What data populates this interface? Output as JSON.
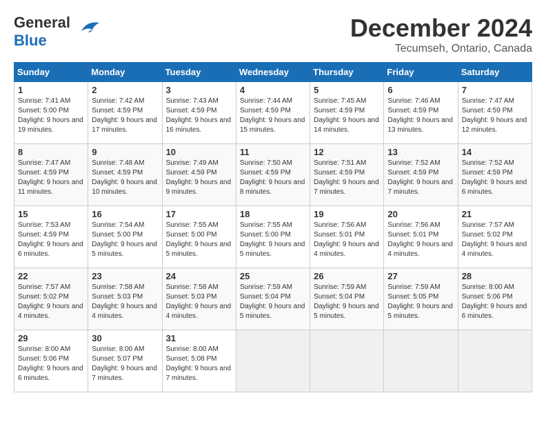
{
  "header": {
    "logo_line1": "General",
    "logo_line2": "Blue",
    "month": "December 2024",
    "location": "Tecumseh, Ontario, Canada"
  },
  "weekdays": [
    "Sunday",
    "Monday",
    "Tuesday",
    "Wednesday",
    "Thursday",
    "Friday",
    "Saturday"
  ],
  "weeks": [
    [
      {
        "day": "1",
        "sunrise": "7:41 AM",
        "sunset": "5:00 PM",
        "daylight": "9 hours and 19 minutes."
      },
      {
        "day": "2",
        "sunrise": "7:42 AM",
        "sunset": "4:59 PM",
        "daylight": "9 hours and 17 minutes."
      },
      {
        "day": "3",
        "sunrise": "7:43 AM",
        "sunset": "4:59 PM",
        "daylight": "9 hours and 16 minutes."
      },
      {
        "day": "4",
        "sunrise": "7:44 AM",
        "sunset": "4:59 PM",
        "daylight": "9 hours and 15 minutes."
      },
      {
        "day": "5",
        "sunrise": "7:45 AM",
        "sunset": "4:59 PM",
        "daylight": "9 hours and 14 minutes."
      },
      {
        "day": "6",
        "sunrise": "7:46 AM",
        "sunset": "4:59 PM",
        "daylight": "9 hours and 13 minutes."
      },
      {
        "day": "7",
        "sunrise": "7:47 AM",
        "sunset": "4:59 PM",
        "daylight": "9 hours and 12 minutes."
      }
    ],
    [
      {
        "day": "8",
        "sunrise": "7:47 AM",
        "sunset": "4:59 PM",
        "daylight": "9 hours and 11 minutes."
      },
      {
        "day": "9",
        "sunrise": "7:48 AM",
        "sunset": "4:59 PM",
        "daylight": "9 hours and 10 minutes."
      },
      {
        "day": "10",
        "sunrise": "7:49 AM",
        "sunset": "4:59 PM",
        "daylight": "9 hours and 9 minutes."
      },
      {
        "day": "11",
        "sunrise": "7:50 AM",
        "sunset": "4:59 PM",
        "daylight": "9 hours and 8 minutes."
      },
      {
        "day": "12",
        "sunrise": "7:51 AM",
        "sunset": "4:59 PM",
        "daylight": "9 hours and 7 minutes."
      },
      {
        "day": "13",
        "sunrise": "7:52 AM",
        "sunset": "4:59 PM",
        "daylight": "9 hours and 7 minutes."
      },
      {
        "day": "14",
        "sunrise": "7:52 AM",
        "sunset": "4:59 PM",
        "daylight": "9 hours and 6 minutes."
      }
    ],
    [
      {
        "day": "15",
        "sunrise": "7:53 AM",
        "sunset": "4:59 PM",
        "daylight": "9 hours and 6 minutes."
      },
      {
        "day": "16",
        "sunrise": "7:54 AM",
        "sunset": "5:00 PM",
        "daylight": "9 hours and 5 minutes."
      },
      {
        "day": "17",
        "sunrise": "7:55 AM",
        "sunset": "5:00 PM",
        "daylight": "9 hours and 5 minutes."
      },
      {
        "day": "18",
        "sunrise": "7:55 AM",
        "sunset": "5:00 PM",
        "daylight": "9 hours and 5 minutes."
      },
      {
        "day": "19",
        "sunrise": "7:56 AM",
        "sunset": "5:01 PM",
        "daylight": "9 hours and 4 minutes."
      },
      {
        "day": "20",
        "sunrise": "7:56 AM",
        "sunset": "5:01 PM",
        "daylight": "9 hours and 4 minutes."
      },
      {
        "day": "21",
        "sunrise": "7:57 AM",
        "sunset": "5:02 PM",
        "daylight": "9 hours and 4 minutes."
      }
    ],
    [
      {
        "day": "22",
        "sunrise": "7:57 AM",
        "sunset": "5:02 PM",
        "daylight": "9 hours and 4 minutes."
      },
      {
        "day": "23",
        "sunrise": "7:58 AM",
        "sunset": "5:03 PM",
        "daylight": "9 hours and 4 minutes."
      },
      {
        "day": "24",
        "sunrise": "7:58 AM",
        "sunset": "5:03 PM",
        "daylight": "9 hours and 4 minutes."
      },
      {
        "day": "25",
        "sunrise": "7:59 AM",
        "sunset": "5:04 PM",
        "daylight": "9 hours and 5 minutes."
      },
      {
        "day": "26",
        "sunrise": "7:59 AM",
        "sunset": "5:04 PM",
        "daylight": "9 hours and 5 minutes."
      },
      {
        "day": "27",
        "sunrise": "7:59 AM",
        "sunset": "5:05 PM",
        "daylight": "9 hours and 5 minutes."
      },
      {
        "day": "28",
        "sunrise": "8:00 AM",
        "sunset": "5:06 PM",
        "daylight": "9 hours and 6 minutes."
      }
    ],
    [
      {
        "day": "29",
        "sunrise": "8:00 AM",
        "sunset": "5:06 PM",
        "daylight": "9 hours and 6 minutes."
      },
      {
        "day": "30",
        "sunrise": "8:00 AM",
        "sunset": "5:07 PM",
        "daylight": "9 hours and 7 minutes."
      },
      {
        "day": "31",
        "sunrise": "8:00 AM",
        "sunset": "5:08 PM",
        "daylight": "9 hours and 7 minutes."
      },
      null,
      null,
      null,
      null
    ]
  ]
}
